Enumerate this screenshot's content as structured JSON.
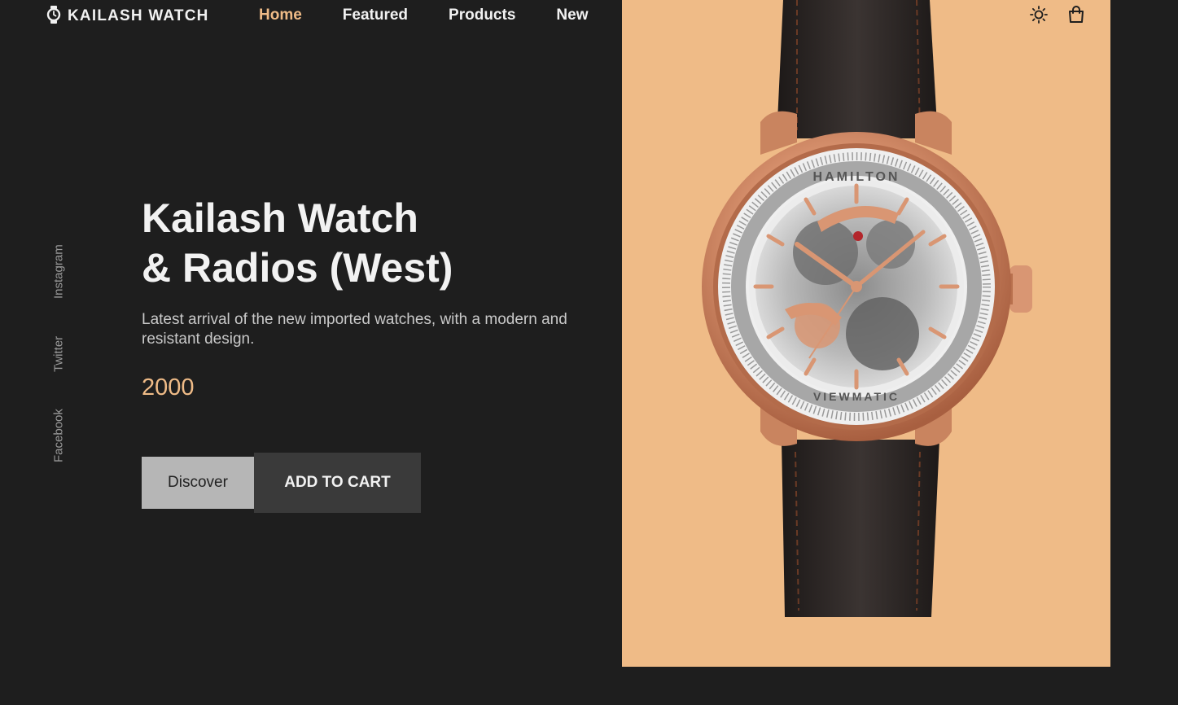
{
  "brand": {
    "name": "KAILASH WATCH",
    "icon": "watch-icon"
  },
  "nav": {
    "items": [
      {
        "label": "Home",
        "active": true
      },
      {
        "label": "Featured",
        "active": false
      },
      {
        "label": "Products",
        "active": false
      },
      {
        "label": "New",
        "active": false
      }
    ]
  },
  "header_icons": {
    "theme": "sun-icon",
    "cart": "shopping-bag-icon"
  },
  "social": {
    "instagram": "Instagram",
    "twitter": "Twitter",
    "facebook": "Facebook"
  },
  "hero": {
    "title_line1": "Kailash Watch",
    "title_line2": "& Radios (West)",
    "description": "Latest arrival of the new imported watches, with a modern and resistant design.",
    "price": "2000",
    "discover_label": "Discover",
    "add_to_cart_label": "ADD TO CART",
    "image_icon": "wristwatch-image"
  },
  "watch_dial": {
    "brand": "HAMILTON",
    "model": "VIEWMATIC"
  },
  "colors": {
    "background": "#1e1e1e",
    "accent": "#efbb87",
    "panel": "#efbb87",
    "discover_button": "#b6b6b6",
    "cart_button": "#3a3a3a"
  }
}
